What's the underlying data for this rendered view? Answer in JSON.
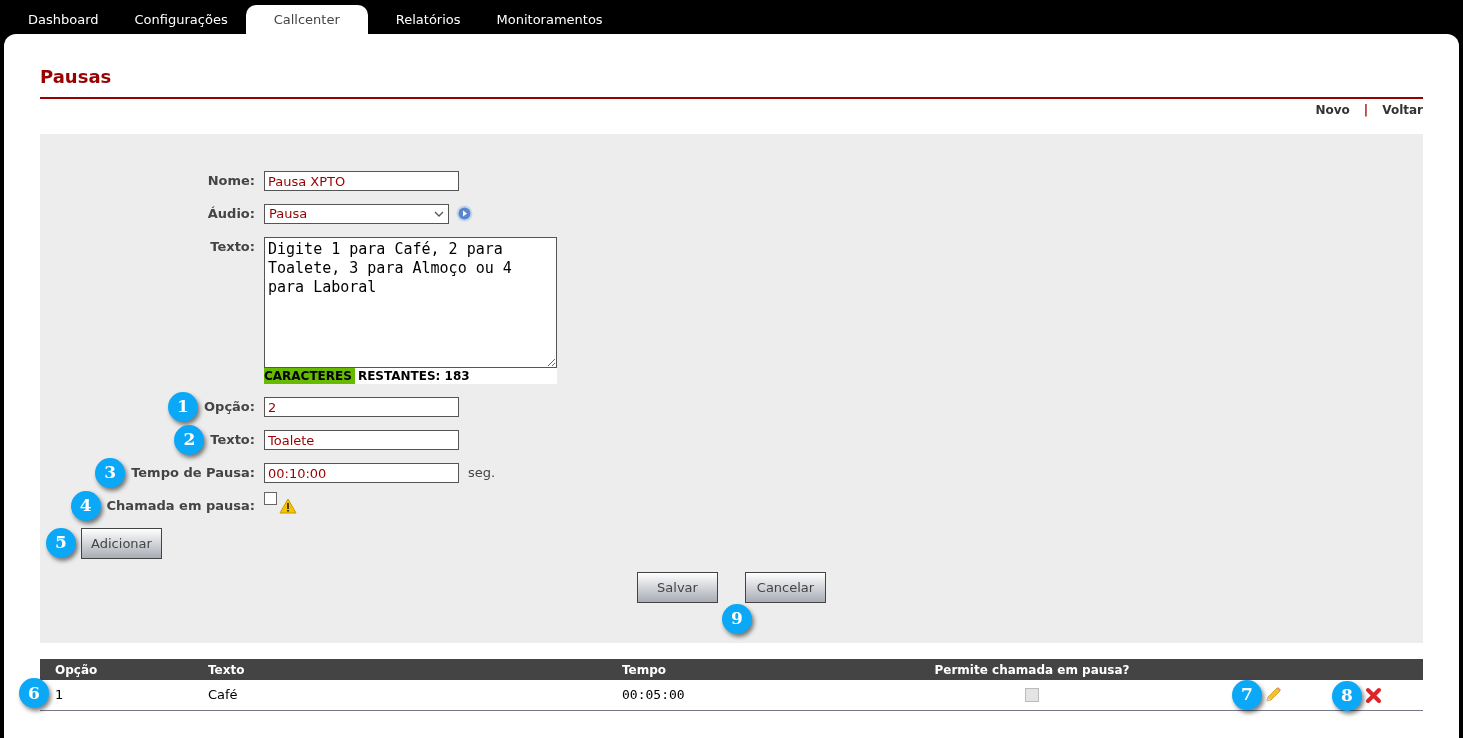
{
  "nav": {
    "tabs": [
      {
        "label": "Dashboard",
        "selected": false
      },
      {
        "label": "Configurações",
        "selected": false
      },
      {
        "label": "Callcenter",
        "selected": true
      },
      {
        "label": "Relatórios",
        "selected": false
      },
      {
        "label": "Monitoramentos",
        "selected": false
      }
    ]
  },
  "page": {
    "title": "Pausas",
    "links": [
      "Novo",
      "Voltar"
    ],
    "separator": "|"
  },
  "form": {
    "fields": [
      {
        "kind": "text",
        "label": "Nome:",
        "value": "Pausa XPTO"
      },
      {
        "kind": "select",
        "label": "Áudio:",
        "value": "Pausa"
      },
      {
        "kind": "textarea",
        "label": "Texto:",
        "value": "Digite 1 para Café, 2 para Toalete, 3 para Almoço ou 4 para Laboral",
        "counter_highlight": "CARACTERES",
        "counter_rest": "RESTANTES: 183"
      },
      {
        "kind": "text",
        "label": "Opção:",
        "value": "2",
        "callout": "1"
      },
      {
        "kind": "text",
        "label": "Texto:",
        "value": "Toalete",
        "callout": "2"
      },
      {
        "kind": "text",
        "label": "Tempo de Pausa:",
        "value": "00:10:00",
        "unit": "seg.",
        "callout": "3"
      },
      {
        "kind": "checkbox",
        "label": "Chamada em pausa:",
        "checked": false,
        "callout": "4"
      }
    ],
    "add_button": {
      "label": "Adicionar",
      "callout": "5"
    },
    "buttons": [
      "Salvar",
      "Cancelar"
    ],
    "buttons_callout": "9"
  },
  "table": {
    "columns": [
      "Opção",
      "Texto",
      "Tempo",
      "Permite chamada em pausa?"
    ],
    "rows": [
      {
        "option": "1",
        "text": "Café",
        "time": "00:05:00",
        "allow_call": false,
        "callout": "6",
        "edit_callout": "7",
        "delete_callout": "8"
      }
    ]
  }
}
